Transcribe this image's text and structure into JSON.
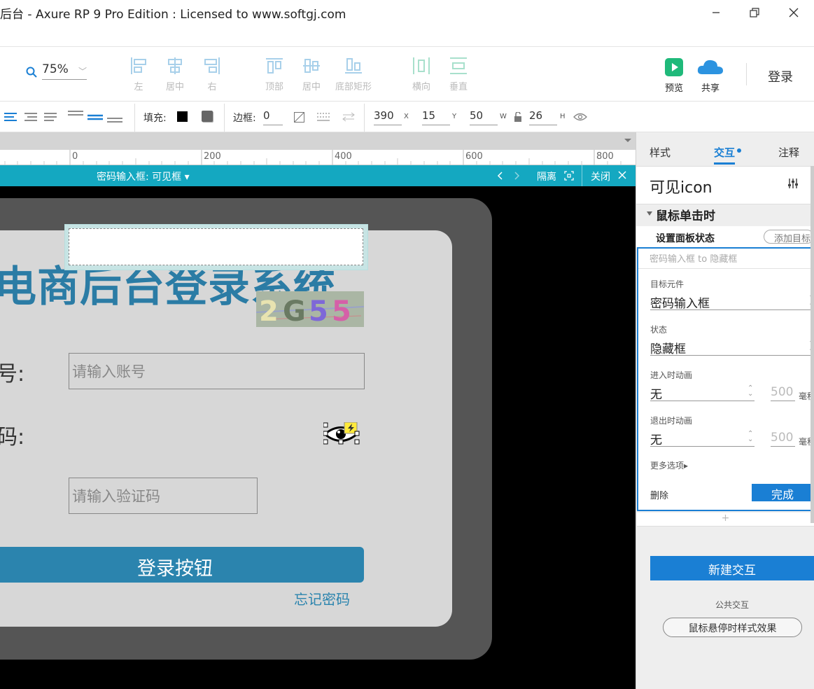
{
  "window": {
    "title": "后台 - Axure RP 9 Pro Edition : Licensed to www.softgj.com"
  },
  "toolbar": {
    "zoom": "75%",
    "align": [
      {
        "label": "左",
        "icon": "align-left-icon"
      },
      {
        "label": "居中",
        "icon": "align-center-icon"
      },
      {
        "label": "右",
        "icon": "align-right-icon"
      },
      {
        "label": "顶部",
        "icon": "align-top-icon"
      },
      {
        "label": "居中",
        "icon": "align-middle-icon"
      },
      {
        "label": "底部矩形",
        "icon": "align-bottom-icon"
      },
      {
        "label": "横向",
        "icon": "distribute-horizontal-icon"
      },
      {
        "label": "垂直",
        "icon": "distribute-vertical-icon"
      }
    ],
    "preview": "预览",
    "share": "共享",
    "login": "登录"
  },
  "formatbar": {
    "fill_label": "填充:",
    "border_label": "边框:",
    "border_value": "0",
    "x": "390",
    "x_unit": "X",
    "y_label": "Y",
    "y_size": "15",
    "y": "50",
    "w": "W",
    "h": "26",
    "h_unit": "H"
  },
  "ruler": {
    "ticks": [
      "0",
      "200",
      "400",
      "600",
      "800"
    ]
  },
  "editbar": {
    "state": "密码输入框: 可见框",
    "isolate": "隔离",
    "close": "关闭"
  },
  "canvas": {
    "title": "电商后台登录系统",
    "account_label": "号:",
    "account_placeholder": "请输入账号",
    "password_label": "码:",
    "captcha_placeholder": "请输入验证码",
    "captcha_text": "2G55",
    "login_button": "登录按钮",
    "forgot": "忘记密码"
  },
  "panel": {
    "tabs": [
      "样式",
      "交互",
      "注释"
    ],
    "element_name": "可见icon",
    "event": "鼠标单击时",
    "action": "设置面板状态",
    "add_target": "添加目标",
    "summary": "密码输入框 to 隐藏框",
    "target_label": "目标元件",
    "target_value": "密码输入框",
    "state_label": "状态",
    "state_value": "隐藏框",
    "enter_anim_label": "进入时动画",
    "enter_anim_value": "无",
    "enter_ms": "500",
    "exit_anim_label": "退出时动画",
    "exit_anim_value": "无",
    "exit_ms": "500",
    "ms_unit": "毫秒",
    "more_options": "更多选项▸",
    "delete": "删除",
    "done": "完成",
    "plus": "+",
    "new_interaction": "新建交互",
    "public_label": "公共交互",
    "hover_style": "鼠标悬停时样式效果"
  },
  "colors": {
    "accent": "#1a7fd4",
    "editbar": "#14a8c1",
    "brand_blue": "#2b84ae"
  }
}
